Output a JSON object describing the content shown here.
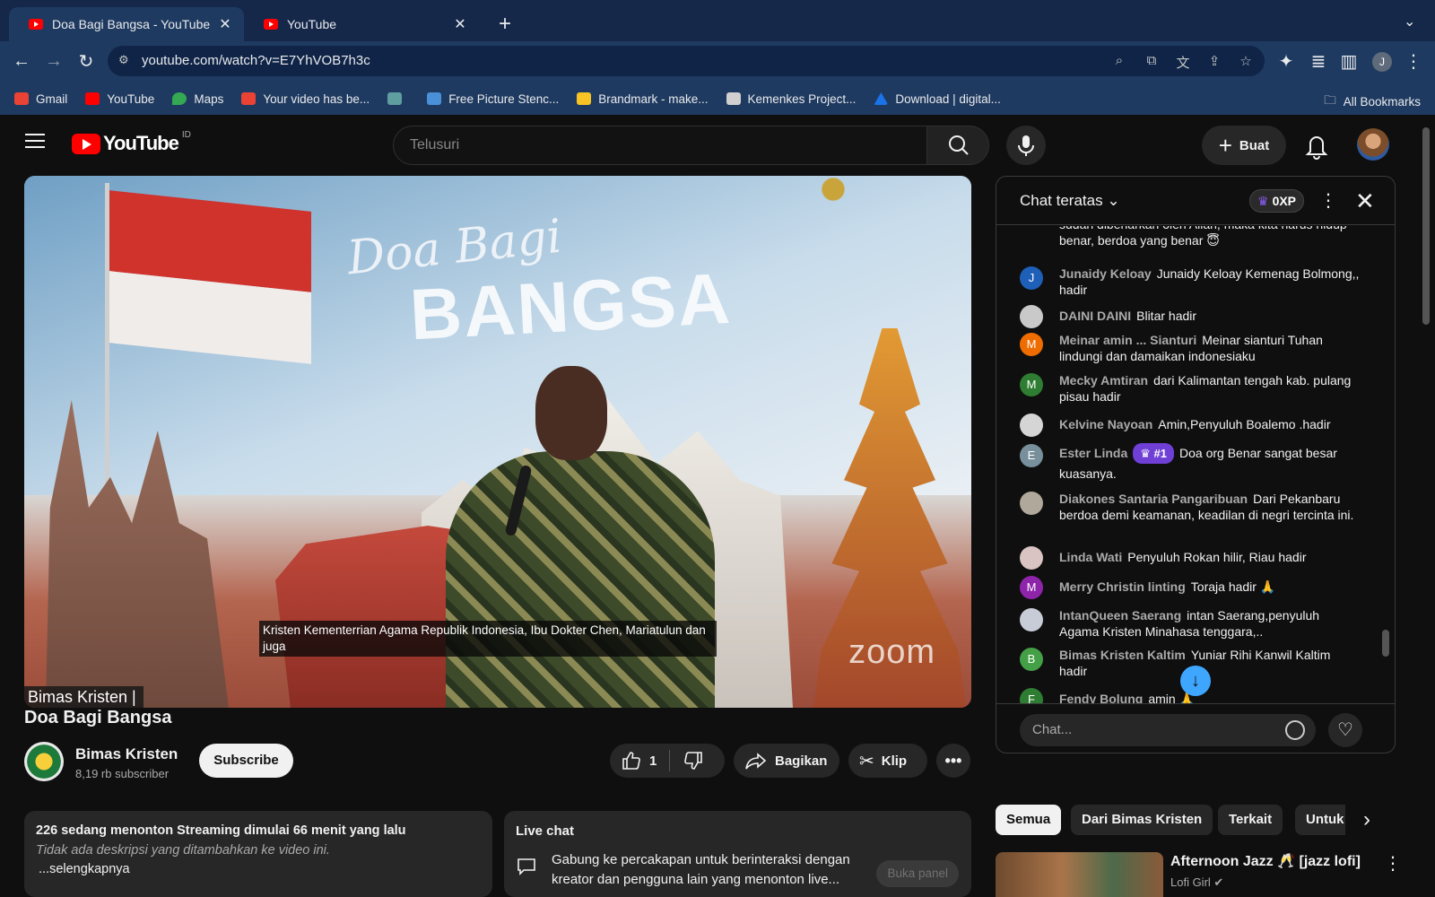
{
  "browser": {
    "tabs": [
      {
        "label": "Doa Bagi Bangsa - YouTube"
      },
      {
        "label": "YouTube"
      }
    ],
    "url": "youtube.com/watch?v=E7YhVOB7h3c",
    "profile_initial": "J",
    "bookmarks": [
      {
        "label": "Gmail",
        "color": "#ea4335"
      },
      {
        "label": "YouTube",
        "color": "#ff0000"
      },
      {
        "label": "Maps",
        "color": "#34a853"
      },
      {
        "label": "Your video has be...",
        "color": "#ea4335"
      },
      {
        "label": "",
        "color": "#5f9ea0"
      },
      {
        "label": "Free Picture Stenc...",
        "color": "#4a90d9"
      },
      {
        "label": "Brandmark - make...",
        "color": "#f7c325"
      },
      {
        "label": "Kemenkes Project...",
        "color": "#d0d0d0"
      },
      {
        "label": "Download | digital...",
        "color": "#1a73e8"
      }
    ],
    "all_bookmarks": "All Bookmarks"
  },
  "youtube": {
    "logo_text": "YouTube",
    "country_code": "ID",
    "search_placeholder": "Telusuri",
    "create_label": "Buat"
  },
  "video": {
    "overlay_title_script": "Doa Bagi",
    "overlay_title_main": "BANGSA",
    "caption": "Kristen Kementerrian Agama Republik Indonesia, Ibu Dokter Chen, Mariatulun dan juga",
    "watermark": "zoom",
    "name_tag": "Bimas Kristen |"
  },
  "meta": {
    "title": "Doa Bagi Bangsa",
    "channel": "Bimas Kristen",
    "subscribers": "8,19 rb subscriber",
    "subscribe_label": "Subscribe",
    "like_count": "1",
    "share_label": "Bagikan",
    "clip_label": "Klip",
    "more_label": "•••",
    "stats": "226 sedang menonton  Streaming dimulai 66 menit yang lalu",
    "no_description": "Tidak ada deskripsi yang ditambahkan ke video ini.",
    "show_more": "...selengkapnya"
  },
  "live_chat_box": {
    "title": "Live chat",
    "description": "Gabung ke percakapan untuk berinteraksi dengan kreator dan pengguna lain yang menonton live...",
    "open_panel": "Buka panel"
  },
  "chat": {
    "title": "Chat teratas",
    "xp": "0XP",
    "input_placeholder": "Chat...",
    "partial_message": "sudah dibenarkan oleh Allah, maka kita harus hidup benar, berdoa yang benar 😇",
    "messages": [
      {
        "author": "Junaidy Keloay",
        "text": "Junaidy Keloay Kemenag Bolmong,, hadir",
        "initial": "J",
        "color": "#1e5fb8"
      },
      {
        "author": "DAINI DAINI",
        "text": "Blitar hadir",
        "initial": "",
        "color": "#c9c9c9"
      },
      {
        "author": "Meinar amin ... Sianturi",
        "text": "Meinar sianturi Tuhan lindungi dan damaikan indonesiaku",
        "initial": "M",
        "color": "#ef6c00"
      },
      {
        "author": "Mecky Amtiran",
        "text": "dari Kalimantan tengah kab. pulang pisau hadir",
        "initial": "M",
        "color": "#2e7d32"
      },
      {
        "author": "Kelvine Nayoan",
        "text": "Amin,Penyuluh Boalemo .hadir",
        "initial": "",
        "color": "#d5d5d5"
      },
      {
        "author": "Ester Linda",
        "badge": "#1",
        "text": "Doa org Benar sangat besar kuasanya.",
        "initial": "E",
        "color": "#78909c"
      },
      {
        "author": "Diakones Santaria Pangaribuan",
        "text": "Dari Pekanbaru berdoa demi keamanan, keadilan di negri tercinta ini.",
        "initial": "",
        "color": "#b0a89a"
      },
      {
        "author": "Linda Wati",
        "text": "Penyuluh Rokan hilir, Riau hadir",
        "initial": "",
        "color": "#d9c3c3"
      },
      {
        "author": "Merry Christin linting",
        "text": "Toraja hadir 🙏",
        "initial": "M",
        "color": "#8e24aa"
      },
      {
        "author": "IntanQueen Saerang",
        "text": "intan Saerang,penyuluh Agama Kristen Minahasa tenggara,..",
        "initial": "",
        "color": "#c7ccd6"
      },
      {
        "author": "Bimas Kristen Kaltim",
        "text": "Yuniar Rihi Kanwil Kaltim hadir",
        "initial": "B",
        "color": "#43a047"
      },
      {
        "author": "Fendy Bolung",
        "text": "amin 🙏",
        "initial": "F",
        "color": "#2e7d32"
      }
    ]
  },
  "chips": [
    "Semua",
    "Dari Bimas Kristen",
    "Terkait",
    "Untuk Anda"
  ],
  "recommendation": {
    "title": "Afternoon Jazz 🥂 [jazz lofi]",
    "channel": "Lofi Girl"
  }
}
